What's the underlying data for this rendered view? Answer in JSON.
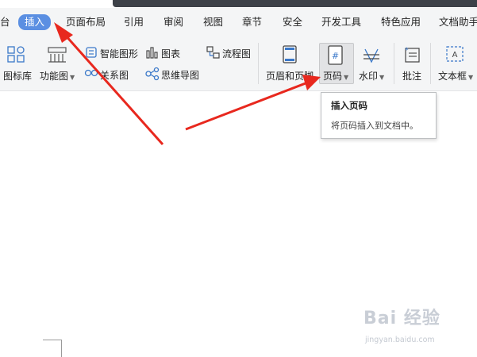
{
  "menu": {
    "partial_left": "台",
    "active_tab": "插入",
    "tabs": [
      "页面布局",
      "引用",
      "审阅",
      "视图",
      "章节",
      "安全",
      "开发工具",
      "特色应用",
      "文档助手"
    ]
  },
  "ribbon": {
    "icon_library": "图标库",
    "function_chart": "功能图",
    "smart_shape": "智能图形",
    "chart": "图表",
    "relation_chart": "关系图",
    "mind_map": "思维导图",
    "flowchart": "流程图",
    "header_footer": "页眉和页脚",
    "page_number": "页码",
    "watermark": "水印",
    "comment": "批注",
    "text_box": "文本框"
  },
  "tooltip": {
    "title": "插入页码",
    "description": "将页码插入到文档中。"
  },
  "watermark_text": {
    "logo": "Bai 经验",
    "url": "jingyan.baidu.com"
  },
  "colors": {
    "accent": "#5b8fe2",
    "arrow": "#e8281e",
    "ribbon_bg": "#f4f5f6"
  }
}
